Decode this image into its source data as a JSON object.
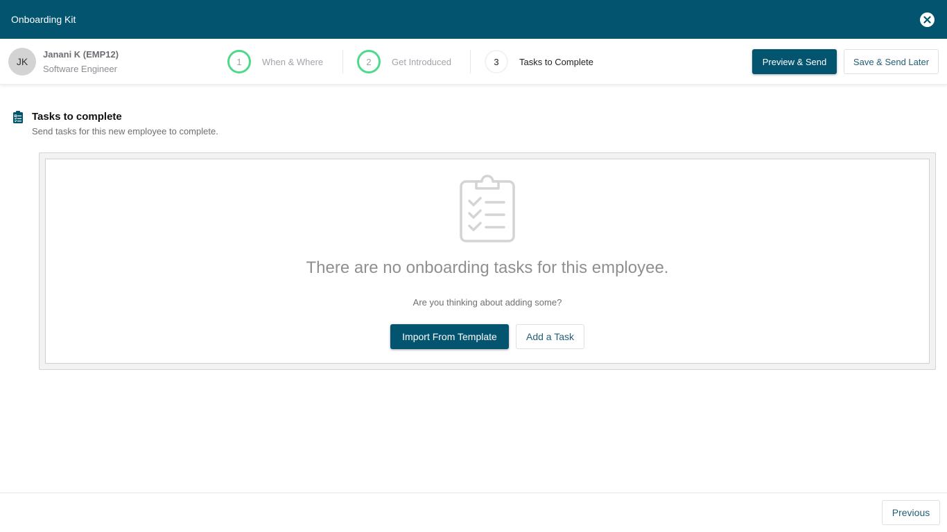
{
  "window": {
    "title": "Onboarding Kit",
    "close_icon": "close-circle-icon"
  },
  "employee": {
    "initials": "JK",
    "name": "Janani K (EMP12)",
    "role": "Software Engineer"
  },
  "steps": [
    {
      "number": "1",
      "label": "When & Where",
      "status": "completed"
    },
    {
      "number": "2",
      "label": "Get Introduced",
      "status": "completed"
    },
    {
      "number": "3",
      "label": "Tasks to Complete",
      "status": "current"
    }
  ],
  "actions": {
    "preview_send": "Preview & Send",
    "save_send_later": "Save & Send Later"
  },
  "section": {
    "icon": "clipboard-checklist-icon",
    "title": "Tasks to complete",
    "subtitle": "Send tasks for this new employee to complete."
  },
  "empty_state": {
    "icon": "clipboard-checklist-icon",
    "title": "There are no onboarding tasks for this employee.",
    "subtitle": "Are you thinking about adding some?",
    "import_button": "Import From Template",
    "add_button": "Add a Task"
  },
  "footer": {
    "previous_button": "Previous"
  },
  "colors": {
    "brand": "#02546f",
    "step_complete": "#4cd98a"
  }
}
